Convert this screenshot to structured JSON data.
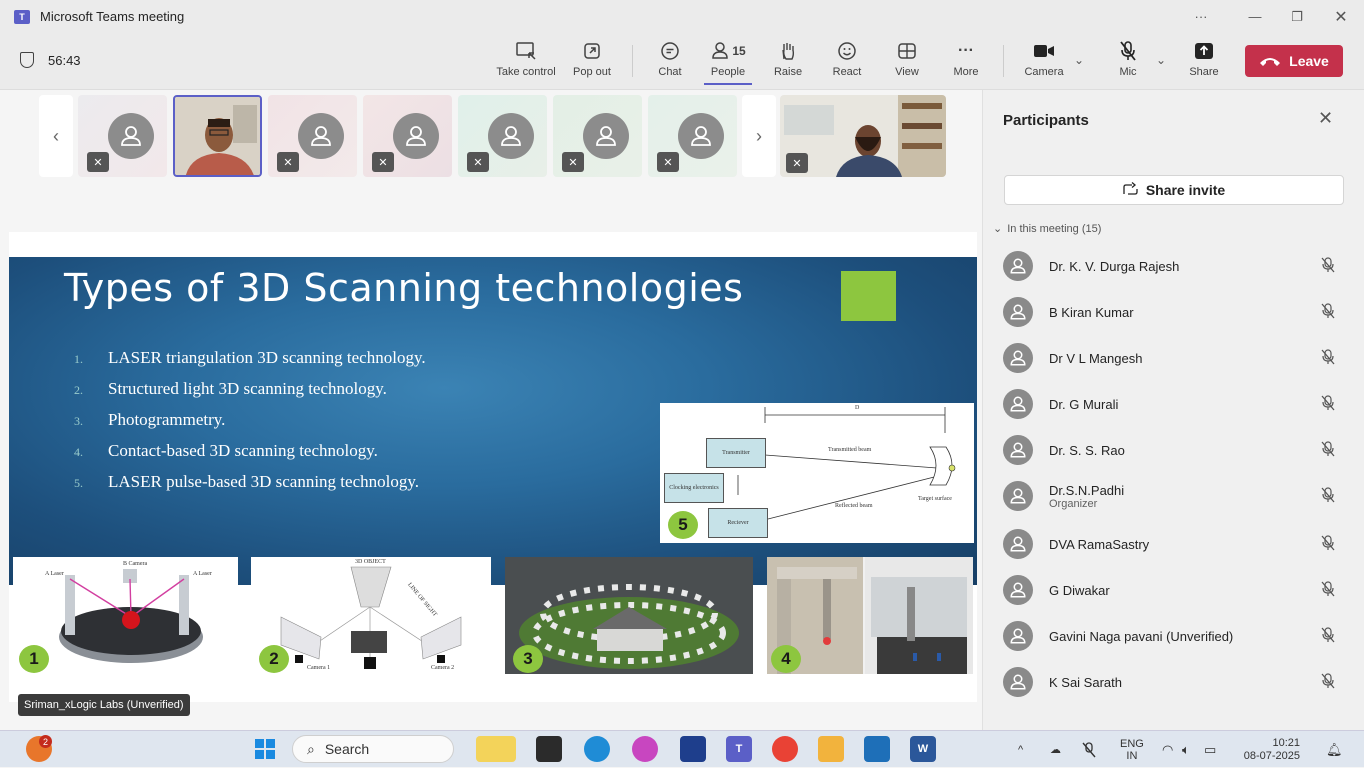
{
  "window": {
    "title": "Microsoft Teams meeting",
    "more_label": "···"
  },
  "toolbar": {
    "timer": "56:43",
    "buttons": [
      {
        "label": "Take control",
        "icon": "take-control-icon"
      },
      {
        "label": "Pop out",
        "icon": "pop-out-icon"
      },
      {
        "label": "Chat",
        "icon": "chat-icon"
      },
      {
        "label": "People",
        "icon": "people-icon",
        "count": "15"
      },
      {
        "label": "Raise",
        "icon": "raise-hand-icon"
      },
      {
        "label": "React",
        "icon": "react-icon"
      },
      {
        "label": "View",
        "icon": "view-icon"
      },
      {
        "label": "More",
        "icon": "more-icon"
      },
      {
        "label": "Camera",
        "icon": "camera-icon"
      },
      {
        "label": "Mic",
        "icon": "mic-off-icon"
      },
      {
        "label": "Share",
        "icon": "share-icon"
      }
    ],
    "leave_label": "Leave"
  },
  "slide": {
    "title": "Types of 3D Scanning technologies",
    "items": [
      {
        "num": "1.",
        "text": "LASER triangulation 3D scanning technology."
      },
      {
        "num": "2.",
        "text": "Structured light 3D scanning technology."
      },
      {
        "num": "3.",
        "text": "Photogrammetry."
      },
      {
        "num": "4.",
        "text": "Contact-based 3D scanning technology."
      },
      {
        "num": "5.",
        "text": "LASER pulse-based 3D scanning technology."
      }
    ],
    "diagram": {
      "d": "D",
      "transmitter": "Transmitter",
      "transmitted_beam": "Transmitted beam",
      "clocking": "Clocking electronics",
      "receiver": "Reciever",
      "reflected_beam": "Reflected beam",
      "target": "Target surface"
    },
    "badges": [
      "1",
      "2",
      "3",
      "4",
      "5"
    ],
    "picture2_labels": {
      "object": "3D OBJECT",
      "line": "LINE OF SIGHT",
      "cam1": "Camera 1",
      "cam2": "Camera 2"
    },
    "picture1_labels": {
      "left": "A Laser",
      "center": "B Camera",
      "right": "A Laser"
    }
  },
  "presenter_caption": "Sriman_xLogic Labs (Unverified)",
  "participants_panel": {
    "title": "Participants",
    "share_invite": "Share invite",
    "section": "In this meeting (15)",
    "people": [
      {
        "name": "Dr. K. V. Durga Rajesh",
        "role": ""
      },
      {
        "name": "B Kiran Kumar",
        "role": ""
      },
      {
        "name": "Dr V L Mangesh",
        "role": ""
      },
      {
        "name": "Dr. G Murali",
        "role": ""
      },
      {
        "name": "Dr. S. S. Rao",
        "role": ""
      },
      {
        "name": "Dr.S.N.Padhi",
        "role": "Organizer"
      },
      {
        "name": "DVA RamaSastry",
        "role": ""
      },
      {
        "name": "G Diwakar",
        "role": ""
      },
      {
        "name": "Gavini Naga pavani (Unverified)",
        "role": ""
      },
      {
        "name": "K Sai Sarath",
        "role": ""
      }
    ]
  },
  "taskbar": {
    "search_placeholder": "Search",
    "notification_count": "2",
    "lang_top": "ENG",
    "lang_bottom": "IN",
    "time": "10:21",
    "date": "08-07-2025"
  },
  "colors": {
    "leave": "#c4314b",
    "accent": "#5b5fc7",
    "slide_green": "#8dc63f"
  }
}
